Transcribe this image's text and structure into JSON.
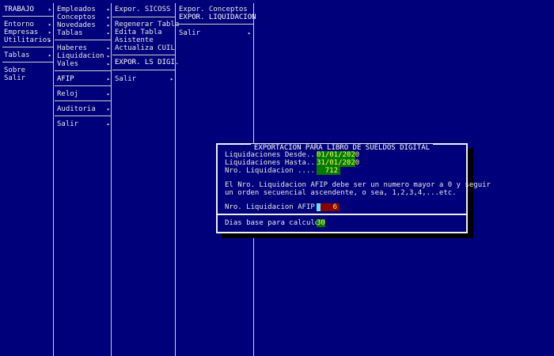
{
  "menu1": {
    "title": "TRABAJO",
    "items": [
      "Entorno",
      "Empresas",
      "Utilitarios",
      "Tablas",
      "Sobre",
      "Salir"
    ]
  },
  "menu2": {
    "items": [
      "Empleados",
      "Conceptos",
      "Novedades",
      "Tablas",
      "Haberes",
      "Liquidacion",
      "Vales",
      "AFIP",
      "Reloj",
      "Auditoria",
      "Salir"
    ]
  },
  "menu3": {
    "items": [
      "Expor. SICOSS",
      "Regenerar Tabla",
      "Edita Tabla",
      "Asistente",
      "Actualiza CUIL",
      "EXPOR. LS DIGI.",
      "Salir"
    ]
  },
  "menu4": {
    "items": [
      "Expor. Conceptos",
      "EXPOR. LIQUIDACION",
      "Salir"
    ]
  },
  "arrow_glyph": "▸",
  "dialog": {
    "title": "EXPORTACION PARA LIBRO DE SUELDOS DIGITAL",
    "desde_label": "Liquidaciones Desde...:",
    "desde_value": "01/01/2020",
    "hasta_label": "Liquidaciones Hasta...:",
    "hasta_value": "31/01/2020",
    "nro_label": "Nro. Liquidacion .....:",
    "nro_value": "712",
    "info_line1": "El Nro. Liquidacion AFIP debe ser un numero mayor a 0 y seguir",
    "info_line2": "un orden secuencial ascendente, o sea, 1,2,3,4,...etc.",
    "afip_label": "Nro. Liquidacion AFIP.:",
    "afip_value": "6",
    "dias_label": "Dias base para calculo:",
    "dias_value": "30"
  },
  "colors": {
    "background": "#00007a",
    "field_green": "#007a00",
    "field_red": "#8a0000",
    "field_text": "#ffff66",
    "cursor": "#66e0ff"
  }
}
